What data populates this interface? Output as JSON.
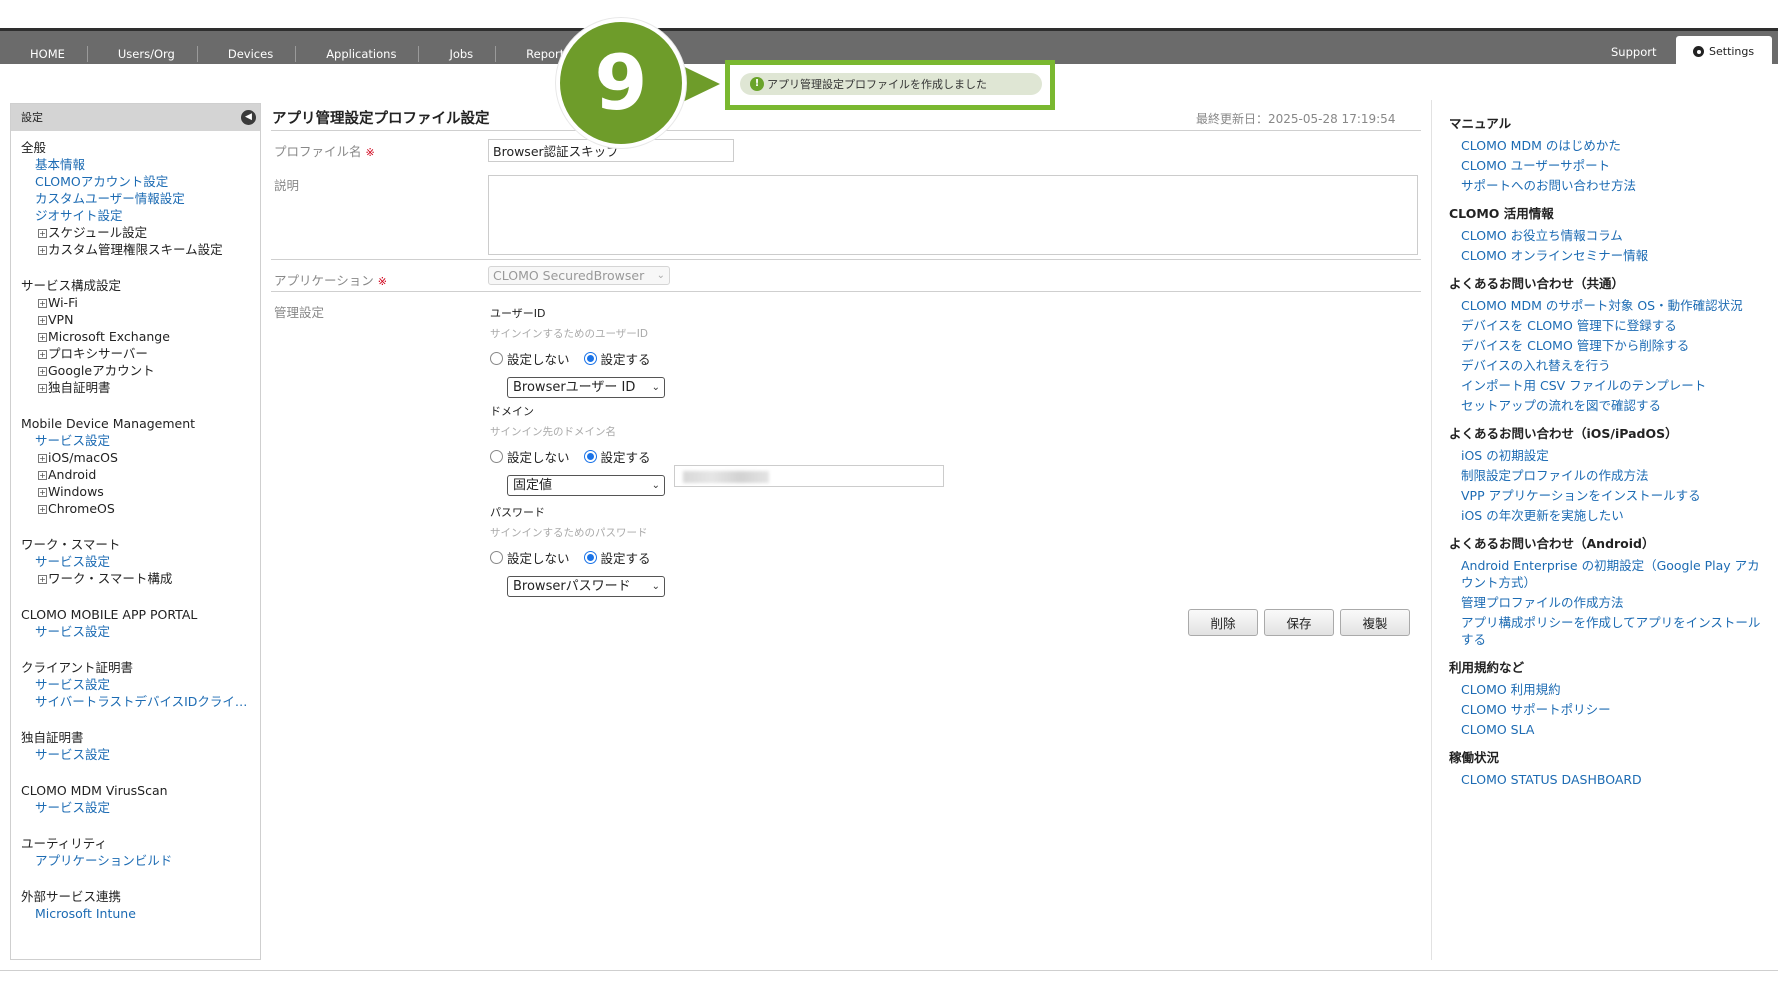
{
  "nav": {
    "items": [
      "HOME",
      "Users/Org",
      "Devices",
      "Applications",
      "Jobs",
      "Reports"
    ],
    "support": "Support",
    "settings": "Settings"
  },
  "toast": {
    "message": "アプリ管理設定プロファイルを作成しました",
    "step_number": "9"
  },
  "sidebar": {
    "header": "設定",
    "groups": [
      {
        "title": "全般",
        "links": [
          "基本情報",
          "CLOMOアカウント設定",
          "カスタムユーザー情報設定",
          "ジオサイト設定"
        ],
        "tree": [
          "スケジュール設定",
          "カスタム管理権限スキーム設定"
        ]
      },
      {
        "title": "サービス構成設定",
        "links": [],
        "tree": [
          "Wi-Fi",
          "VPN",
          "Microsoft Exchange",
          "プロキシサーバー",
          "Googleアカウント",
          "独自証明書"
        ]
      },
      {
        "title": "Mobile Device Management",
        "links": [
          "サービス設定"
        ],
        "tree": [
          "iOS/macOS",
          "Android",
          "Windows",
          "ChromeOS"
        ]
      },
      {
        "title": "ワーク・スマート",
        "links": [
          "サービス設定"
        ],
        "tree": [
          "ワーク・スマート構成"
        ]
      },
      {
        "title": "CLOMO MOBILE APP PORTAL",
        "links": [
          "サービス設定"
        ],
        "tree": []
      },
      {
        "title": "クライアント証明書",
        "links": [
          "サービス設定",
          "サイバートラストデバイスIDクライ…"
        ],
        "tree": []
      },
      {
        "title": "独自証明書",
        "links": [
          "サービス設定"
        ],
        "tree": []
      },
      {
        "title": "CLOMO MDM VirusScan",
        "links": [
          "サービス設定"
        ],
        "tree": []
      },
      {
        "title": "ユーティリティ",
        "links": [
          "アプリケーションビルド"
        ],
        "tree": []
      },
      {
        "title": "外部サービス連携",
        "links": [
          "Microsoft Intune"
        ],
        "tree": []
      }
    ]
  },
  "main": {
    "title": "アプリ管理設定プロファイル設定",
    "last_updated": "最終更新日：2025-05-28 17:19:54",
    "profile_name_label": "プロファイル名",
    "profile_name_value": "Browser認証スキップ",
    "required_mark": "※",
    "description_label": "説明",
    "description_value": "",
    "application_label": "アプリケーション",
    "application_value": "CLOMO SecuredBrowser",
    "management_label": "管理設定",
    "radio_off": "設定しない",
    "radio_on": "設定する",
    "user_id": {
      "title": "ユーザーID",
      "sub": "サインインするためのユーザーID",
      "select": "Browserユーザー ID"
    },
    "domain": {
      "title": "ドメイン",
      "sub": "サインイン先のドメイン名",
      "select": "固定値"
    },
    "password": {
      "title": "パスワード",
      "sub": "サインインするためのパスワード",
      "select": "Browserパスワード"
    },
    "buttons": {
      "delete": "削除",
      "save": "保存",
      "duplicate": "複製"
    }
  },
  "right_panel": {
    "sections": [
      {
        "heading": "マニュアル",
        "links": [
          "CLOMO MDM のはじめかた",
          "CLOMO ユーザーサポート",
          "サポートへのお問い合わせ方法"
        ]
      },
      {
        "heading": "CLOMO 活用情報",
        "links": [
          "CLOMO お役立ち情報コラム",
          "CLOMO オンラインセミナー情報"
        ]
      },
      {
        "heading": "よくあるお問い合わせ（共通）",
        "links": [
          "CLOMO MDM のサポート対象 OS・動作確認状況",
          "デバイスを CLOMO 管理下に登録する",
          "デバイスを CLOMO 管理下から削除する",
          "デバイスの入れ替えを行う",
          "インポート用 CSV ファイルのテンプレート",
          "セットアップの流れを図で確認する"
        ]
      },
      {
        "heading": "よくあるお問い合わせ（iOS/iPadOS）",
        "links": [
          "iOS の初期設定",
          "制限設定プロファイルの作成方法",
          "VPP アプリケーションをインストールする",
          "iOS の年次更新を実施したい"
        ]
      },
      {
        "heading": "よくあるお問い合わせ（Android）",
        "links": [
          "Android Enterprise の初期設定（Google Play アカウント方式）",
          "管理プロファイルの作成方法",
          "アプリ構成ポリシーを作成してアプリをインストールする"
        ]
      },
      {
        "heading": "利用規約など",
        "links": [
          "CLOMO 利用規約",
          "CLOMO サポートポリシー",
          "CLOMO SLA"
        ]
      },
      {
        "heading": "稼働状況",
        "links": [
          "CLOMO STATUS DASHBOARD"
        ]
      }
    ]
  }
}
